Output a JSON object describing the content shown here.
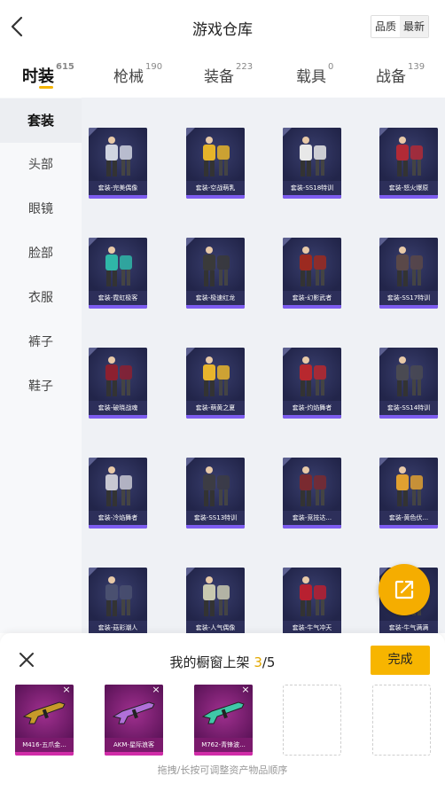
{
  "header": {
    "title": "游戏仓库",
    "sort_options": [
      "品质",
      "最新"
    ]
  },
  "tabs": [
    {
      "label": "时装",
      "count": "615",
      "active": true
    },
    {
      "label": "枪械",
      "count": "190",
      "active": false
    },
    {
      "label": "装备",
      "count": "223",
      "active": false
    },
    {
      "label": "载具",
      "count": "0",
      "active": false
    },
    {
      "label": "战备",
      "count": "139",
      "active": false
    }
  ],
  "sidebar": {
    "items": [
      "套装",
      "头部",
      "眼镜",
      "脸部",
      "衣服",
      "裤子",
      "鞋子"
    ],
    "active_index": 0
  },
  "items": [
    {
      "name": "套装-完美偶像",
      "color": "#d0d4e0"
    },
    {
      "name": "套装-空战萌乳",
      "color": "#e6b42a"
    },
    {
      "name": "套装-SS18特训",
      "color": "#e8e8e8"
    },
    {
      "name": "套装-怒火爆原",
      "color": "#b22a36"
    },
    {
      "name": "套装-霓虹极客",
      "color": "#2fb7a8"
    },
    {
      "name": "套装-极速红龙",
      "color": "#3a3a3a"
    },
    {
      "name": "套装-幻影武者",
      "color": "#9c2a20"
    },
    {
      "name": "套装-SS17特训",
      "color": "#5a4848"
    },
    {
      "name": "套装-破晓战魂",
      "color": "#8c2030"
    },
    {
      "name": "套装-萌黄之夏",
      "color": "#e9b52c"
    },
    {
      "name": "套装-灼焰舞者",
      "color": "#b8282e"
    },
    {
      "name": "套装-SS14特训",
      "color": "#4a4a52"
    },
    {
      "name": "套装-冷焰舞者",
      "color": "#c8c8d2"
    },
    {
      "name": "套装-SS13特训",
      "color": "#3c3c44"
    },
    {
      "name": "套装-竞技达...",
      "color": "#7a2a30"
    },
    {
      "name": "套装-黄色伏...",
      "color": "#e0a030"
    },
    {
      "name": "套装-菇彩潮人",
      "color": "#4a5070"
    },
    {
      "name": "套装-人气偶像",
      "color": "#c9c9b0"
    },
    {
      "name": "套装-牛气冲天",
      "color": "#b82030"
    },
    {
      "name": "套装-牛气满满",
      "color": "#a02040"
    }
  ],
  "panel": {
    "title_prefix": "我的橱窗上架 ",
    "count_current": "3",
    "count_total": "/5",
    "done_label": "完成",
    "hint": "拖拽/长按可调整资产物品顺序",
    "slots": [
      {
        "label": "M416-五爪金...",
        "color": "#c79a2a"
      },
      {
        "label": "AKM-星际浪客",
        "color": "#b070d8"
      },
      {
        "label": "M762-青锋波...",
        "color": "#3fc8a8"
      }
    ],
    "empty_slots": 2
  },
  "icons": {
    "back": "chevron-left-icon",
    "share": "external-link-icon",
    "close": "close-icon",
    "remove": "×"
  }
}
